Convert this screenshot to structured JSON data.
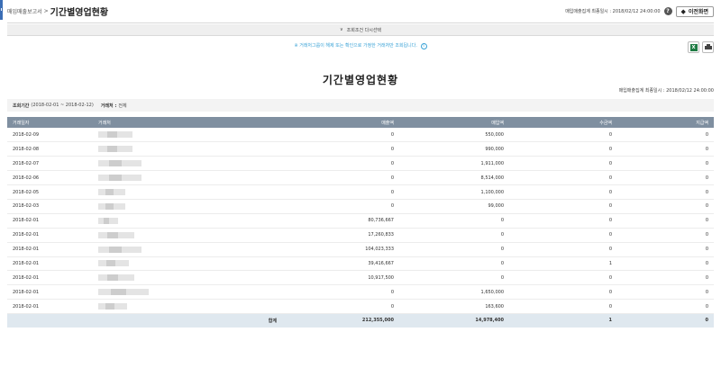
{
  "header": {
    "breadcrumb_parent": "매입매출보고서",
    "breadcrumb_sep": ">",
    "title": "기간별영업현황",
    "sync_text": "매입매출집계 최종일시 : 2018/02/12 24:00:00",
    "help_glyph": "?",
    "back_label": "이전화면",
    "back_glyph": "◆"
  },
  "filter_toggle": {
    "glyph": "∨",
    "label": "조회조건 다시선택"
  },
  "notice": {
    "text": "※ 거래처그룹이 해제 또는 확인으로 가정한 거래처만 조회됩니다.",
    "icon_glyph": "i"
  },
  "tools": {
    "excel_glyph": "X"
  },
  "report": {
    "title": "기간별영업현황",
    "sync_text": "매입매출집계 최종일시 : 2018/02/12 24:00:00"
  },
  "conditions": {
    "period_label": "조회기간",
    "period_value": "(2018-02-01 ~ 2018-02-12)",
    "customer_label": "거래처 :",
    "customer_value": "전체"
  },
  "table": {
    "columns": [
      "거래일자",
      "거래처",
      "매출액",
      "매입액",
      "수금액",
      "지급액"
    ],
    "rows": [
      {
        "date": "2018-02-09",
        "sales": "0",
        "purchase": "550,000",
        "collected": "0",
        "paid": "0"
      },
      {
        "date": "2018-02-08",
        "sales": "0",
        "purchase": "990,000",
        "collected": "0",
        "paid": "0"
      },
      {
        "date": "2018-02-07",
        "sales": "0",
        "purchase": "1,911,000",
        "collected": "0",
        "paid": "0"
      },
      {
        "date": "2018-02-06",
        "sales": "0",
        "purchase": "8,514,000",
        "collected": "0",
        "paid": "0"
      },
      {
        "date": "2018-02-05",
        "sales": "0",
        "purchase": "1,100,000",
        "collected": "0",
        "paid": "0"
      },
      {
        "date": "2018-02-03",
        "sales": "0",
        "purchase": "99,000",
        "collected": "0",
        "paid": "0"
      },
      {
        "date": "2018-02-01",
        "sales": "80,736,667",
        "purchase": "0",
        "collected": "0",
        "paid": "0"
      },
      {
        "date": "2018-02-01",
        "sales": "17,260,833",
        "purchase": "0",
        "collected": "0",
        "paid": "0"
      },
      {
        "date": "2018-02-01",
        "sales": "104,023,333",
        "purchase": "0",
        "collected": "0",
        "paid": "0"
      },
      {
        "date": "2018-02-01",
        "sales": "39,416,667",
        "purchase": "0",
        "collected": "1",
        "paid": "0"
      },
      {
        "date": "2018-02-01",
        "sales": "10,917,500",
        "purchase": "0",
        "collected": "0",
        "paid": "0"
      },
      {
        "date": "2018-02-01",
        "sales": "0",
        "purchase": "1,650,000",
        "collected": "0",
        "paid": "0"
      },
      {
        "date": "2018-02-01",
        "sales": "0",
        "purchase": "163,600",
        "collected": "0",
        "paid": "0"
      }
    ],
    "totals": {
      "label": "합계",
      "sales": "212,355,000",
      "purchase": "14,978,400",
      "collected": "1",
      "paid": "0"
    }
  }
}
